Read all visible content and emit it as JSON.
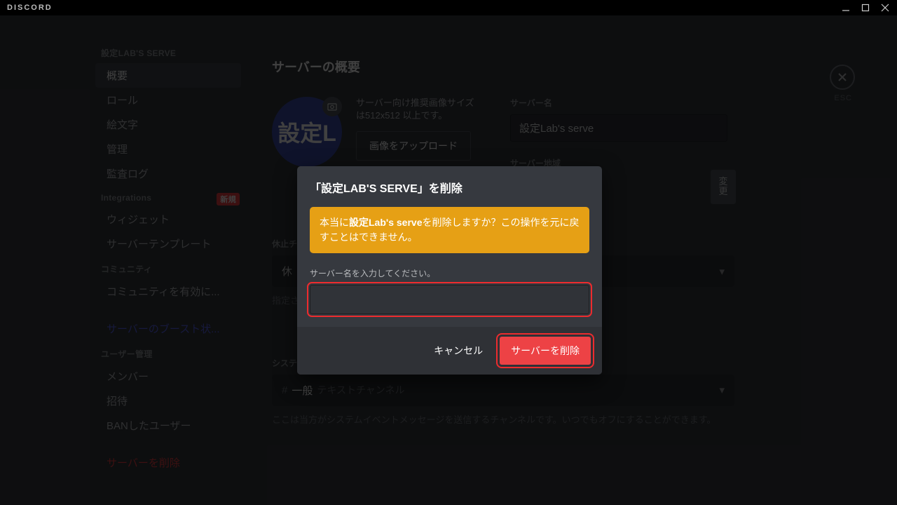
{
  "titlebar": {
    "brand": "DISCORD"
  },
  "close": {
    "esc": "ESC"
  },
  "sidebar": {
    "h1": "設定LAB'S SERVE",
    "items1": [
      "概要",
      "ロール",
      "絵文字",
      "管理",
      "監査ログ"
    ],
    "h2": "Integrations",
    "badge": "新規",
    "items2": [
      "ウィジェット",
      "サーバーテンプレート"
    ],
    "h3": "コミュニティ",
    "items3": [
      "コミュニティを有効に..."
    ],
    "boost": "サーバーのブースト状...",
    "h4": "ユーザー管理",
    "items4": [
      "メンバー",
      "招待",
      "BANしたユーザー"
    ],
    "danger": "サーバーを削除"
  },
  "content": {
    "title": "サーバーの概要",
    "avatar_text": "設定L",
    "hint": "サーバー向け推奨画像サイズは512x512 以上です。",
    "upload_btn": "画像をアップロード",
    "name_label": "サーバー名",
    "name_value": "設定Lab's serve",
    "region_label": "サーバー地域",
    "change_btn": "変更",
    "idle_label": "休止チ",
    "idle_select": "休",
    "idle_note": "指定されたチャンネルに自動的に移動され",
    "sys_label": "システムのメッセージチャンネル",
    "sys_hash": "#",
    "sys_chan": "一般",
    "sys_suffix": "テキストチャンネル",
    "sys_note": "ここは当方がシステムイベントメッセージを送信するチャンネルです。いつでもオフにすることができます。"
  },
  "modal": {
    "title": "「設定LAB'S SERVE」を削除",
    "warn_pre": "本当に",
    "warn_bold": "設定Lab's serve",
    "warn_post": "を削除しますか？この操作を元に戻すことはできません。",
    "confirm_label": "サーバー名を入力してください。",
    "cancel": "キャンセル",
    "delete": "サーバーを削除"
  }
}
